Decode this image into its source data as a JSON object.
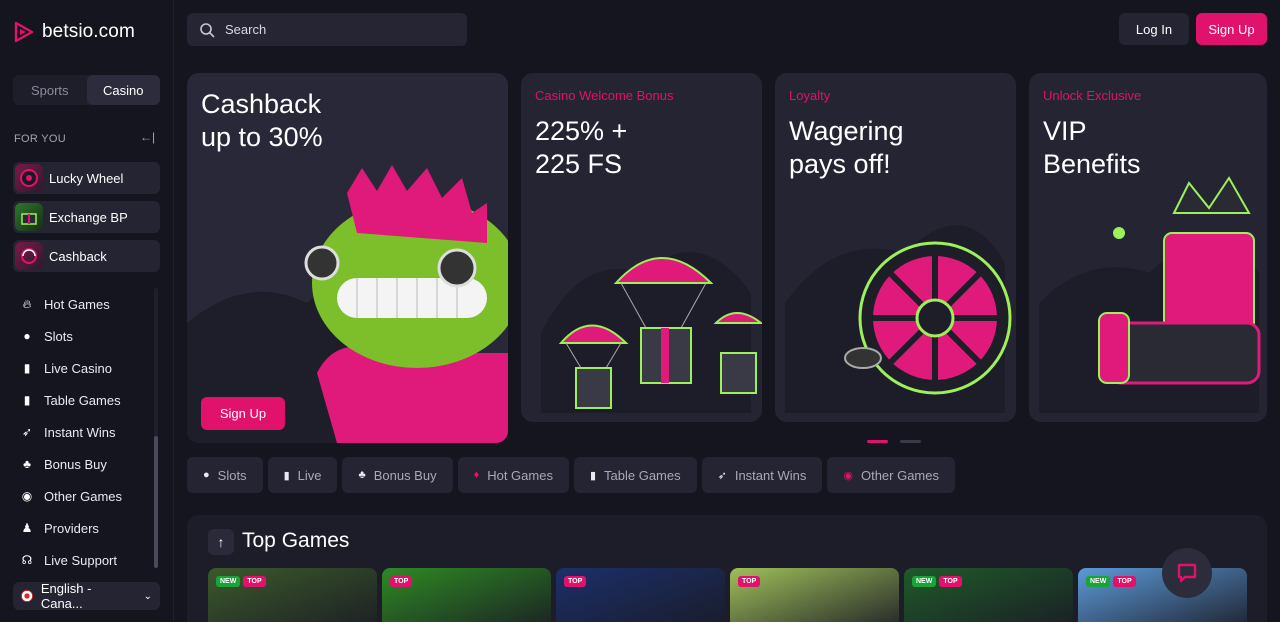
{
  "brand": {
    "name": "betsio.com",
    "accent": "#e0126c"
  },
  "header": {
    "search_placeholder": "Search",
    "login_label": "Log In",
    "signup_label": "Sign Up"
  },
  "sidebar": {
    "modes": [
      {
        "label": "Sports"
      },
      {
        "label": "Casino",
        "active": true
      }
    ],
    "for_you_label": "FOR YOU",
    "collapse_icon": "collapse-arrow-icon",
    "promos": [
      {
        "label": "Lucky Wheel",
        "icon": "wheel-icon"
      },
      {
        "label": "Exchange BP",
        "icon": "gift-icon"
      },
      {
        "label": "Cashback",
        "icon": "cashback-icon"
      }
    ],
    "nav": [
      {
        "label": "Hot Games",
        "icon": "flame-icon"
      },
      {
        "label": "Slots",
        "icon": "cherries-icon"
      },
      {
        "label": "Live Casino",
        "icon": "card-icon"
      },
      {
        "label": "Table Games",
        "icon": "card-icon"
      },
      {
        "label": "Instant Wins",
        "icon": "rocket-icon"
      },
      {
        "label": "Bonus Buy",
        "icon": "bag-icon"
      },
      {
        "label": "Other Games",
        "icon": "chip-icon"
      },
      {
        "label": "Providers",
        "icon": "providers-icon"
      },
      {
        "label": "Live Support",
        "icon": "headset-icon"
      }
    ],
    "language": "English - Cana..."
  },
  "banners": [
    {
      "subtitle": "",
      "title": "Cashback\nup to 30%",
      "cta": "Sign Up"
    },
    {
      "subtitle": "Casino Welcome Bonus",
      "title": "225% +\n225 FS"
    },
    {
      "subtitle": "Loyalty",
      "title": "Wagering\npays off!"
    },
    {
      "subtitle": "Unlock Exclusive",
      "title": "VIP\nBenefits"
    }
  ],
  "carousel": {
    "pages": 2,
    "active": 1
  },
  "categories": [
    {
      "label": "Slots",
      "icon": "cherries-icon"
    },
    {
      "label": "Live",
      "icon": "card-icon"
    },
    {
      "label": "Bonus Buy",
      "icon": "bag-icon"
    },
    {
      "label": "Hot Games",
      "icon": "flame-icon"
    },
    {
      "label": "Table Games",
      "icon": "card-icon"
    },
    {
      "label": "Instant Wins",
      "icon": "rocket-icon"
    },
    {
      "label": "Other Games",
      "icon": "chip-icon"
    }
  ],
  "top_games": {
    "title": "Top Games",
    "badge_new": "NEW",
    "badge_top": "TOP",
    "tiles": [
      {
        "badges": [
          "NEW",
          "TOP"
        ],
        "color": "#3b5a2b"
      },
      {
        "badges": [
          "TOP"
        ],
        "color": "#2e8a23"
      },
      {
        "badges": [
          "TOP"
        ],
        "color": "#1b2f6a"
      },
      {
        "badges": [
          "TOP"
        ],
        "color": "#9fbf5a"
      },
      {
        "badges": [
          "NEW",
          "TOP"
        ],
        "color": "#1f5a2a"
      },
      {
        "badges": [
          "NEW",
          "TOP"
        ],
        "color": "#5c9ad8"
      }
    ]
  }
}
